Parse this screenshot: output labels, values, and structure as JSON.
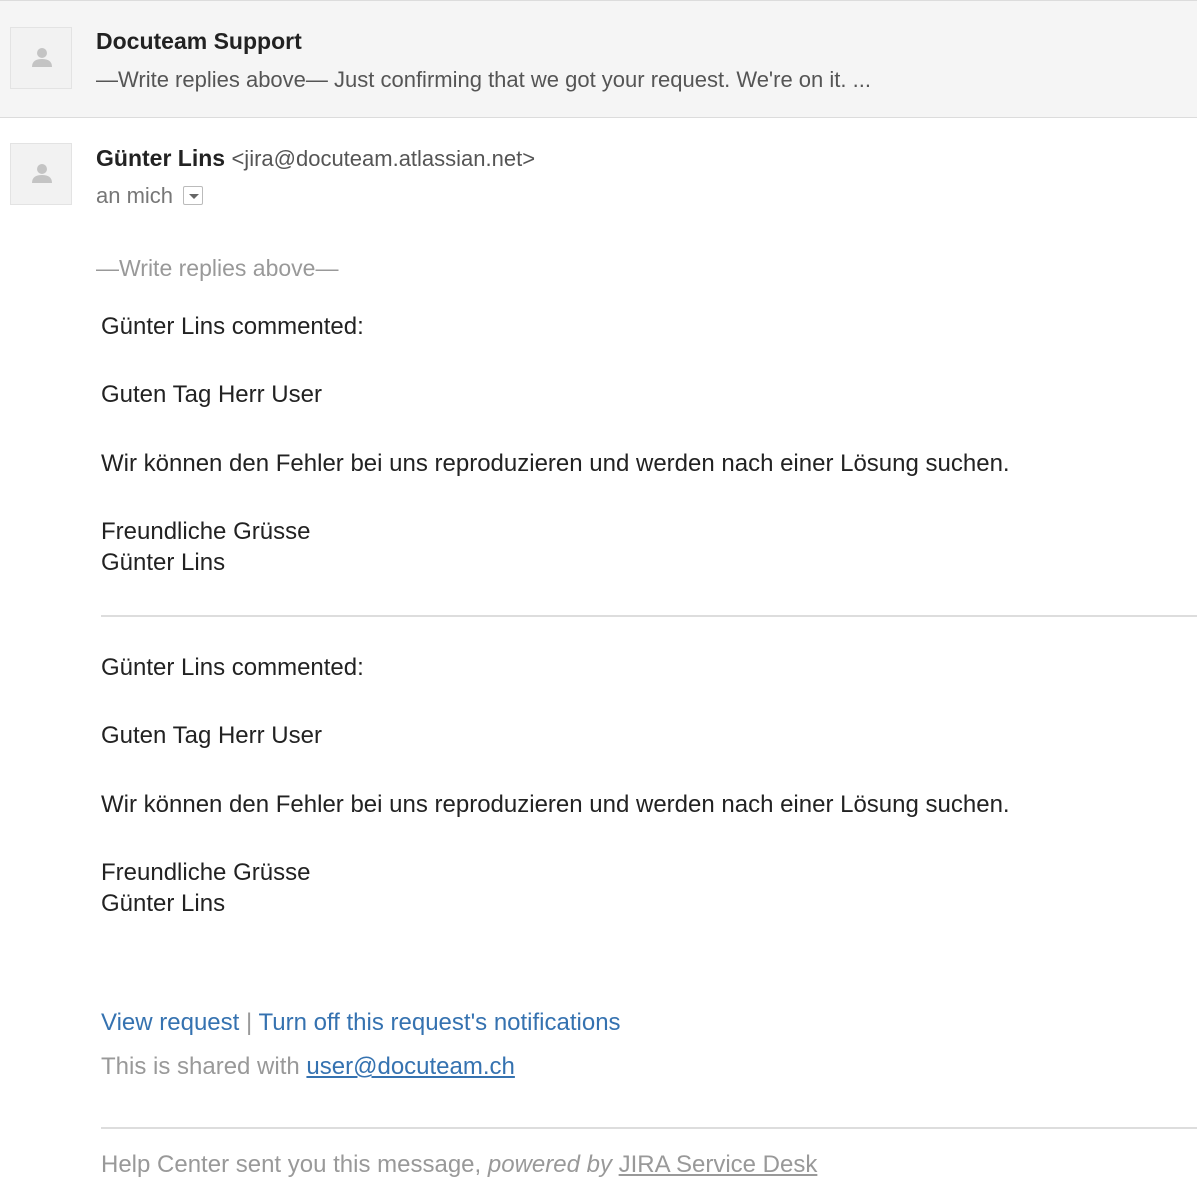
{
  "collapsed_message": {
    "sender": "Docuteam Support",
    "snippet": "—Write replies above— Just confirming that we got your request. We're on it. ..."
  },
  "open_message": {
    "sender_name": "Günter Lins",
    "sender_email": "<jira@docuteam.atlassian.net>",
    "recipient": "an mich",
    "reply_marker": "—Write replies above—",
    "comments": [
      {
        "header": "Günter Lins commented:",
        "greeting": "Guten Tag Herr User",
        "body": "Wir können den Fehler bei uns reproduzieren und werden nach einer Lösung suchen.",
        "closing": "Freundliche Grüsse",
        "signature": "Günter Lins"
      },
      {
        "header": "Günter Lins commented:",
        "greeting": "Guten Tag Herr User",
        "body": "Wir können den Fehler bei uns reproduzieren und werden nach einer Lösung suchen.",
        "closing": "Freundliche Grüsse",
        "signature": "Günter Lins"
      }
    ],
    "footer": {
      "view_request": "View request",
      "separator": "|",
      "turn_off": "Turn off this request's notifications",
      "shared_prefix": "This is shared with",
      "shared_email": "user@docuteam.ch",
      "help_prefix": "Help Center sent you this message,",
      "powered_by": "powered by",
      "jira_link": "JIRA Service Desk"
    }
  },
  "colors": {
    "link": "#3572b0",
    "muted": "#999999",
    "collapsed_bg": "#f5f5f5"
  },
  "icons": {
    "avatar": "person-silhouette-icon",
    "dropdown": "chevron-down-icon"
  }
}
